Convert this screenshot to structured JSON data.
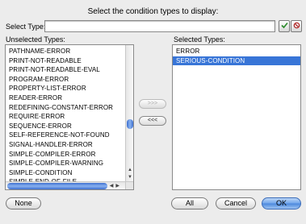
{
  "dialog": {
    "title": "Select the condition types to display:",
    "select_type_label": "Select Type:",
    "search_value": "",
    "confirm_icon": "check-icon",
    "clear_icon": "clear-icon"
  },
  "unselected": {
    "label": "Unselected Types:",
    "items": [
      "PATHNAME-ERROR",
      "PRINT-NOT-READABLE",
      "PRINT-NOT-READABLE-EVAL",
      "PROGRAM-ERROR",
      "PROPERTY-LIST-ERROR",
      "READER-ERROR",
      "REDEFINING-CONSTANT-ERROR",
      "REQUIRE-ERROR",
      "SEQUENCE-ERROR",
      "SELF-REFERENCE-NOT-FOUND",
      "SIGNAL-HANDLER-ERROR",
      "SIMPLE-COMPILER-ERROR",
      "SIMPLE-COMPILER-WARNING",
      "SIMPLE-CONDITION",
      "SIMPLE-END-OF-FILE"
    ]
  },
  "selected": {
    "label": "Selected Types:",
    "items": [
      "ERROR",
      "SERIOUS-CONDITION"
    ],
    "highlighted_index": 1
  },
  "transfer": {
    "add_label": ">>>",
    "remove_label": "<<<"
  },
  "buttons": {
    "none_label": "None",
    "all_label": "All",
    "cancel_label": "Cancel",
    "ok_label": "OK"
  },
  "colors": {
    "selection": "#3875d7",
    "default_button": "#4a87dc"
  }
}
